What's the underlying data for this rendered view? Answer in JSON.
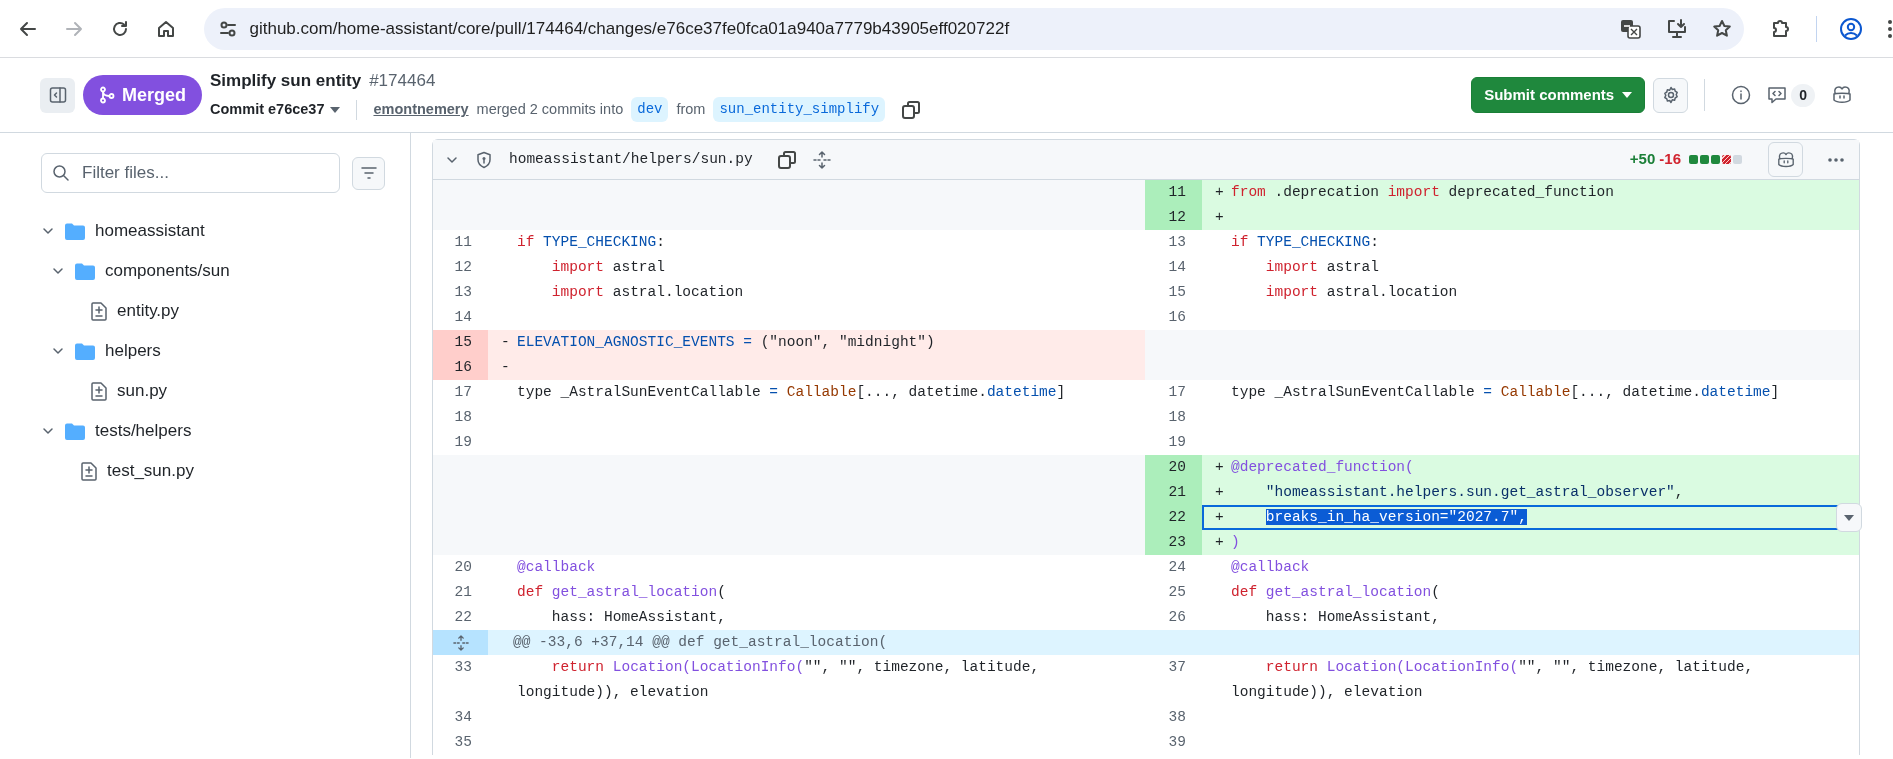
{
  "browser": {
    "url": "github.com/home-assistant/core/pull/174464/changes/e76ce37fe0fca01a940a7779b43905eff020722f",
    "forward_disabled": true
  },
  "header": {
    "status": "Merged",
    "title": "Simplify sun entity",
    "number": "#174464",
    "commit": "Commit e76ce37",
    "author": "emontnemery",
    "merge_text": "merged 2 commits into",
    "base": "dev",
    "from_text": "from",
    "head": "sun_entity_simplify",
    "submit": "Submit comments",
    "comment_count": "0"
  },
  "sidebar": {
    "filter": {
      "placeholder": "Filter files..."
    },
    "tree": [
      {
        "kind": "folder",
        "label": "homeassistant",
        "expanded": true,
        "children": [
          {
            "kind": "folder",
            "label": "components/sun",
            "expanded": true,
            "children": [
              {
                "kind": "file",
                "label": "entity.py"
              }
            ]
          },
          {
            "kind": "folder",
            "label": "helpers",
            "expanded": true,
            "children": [
              {
                "kind": "file",
                "label": "sun.py"
              }
            ]
          }
        ]
      },
      {
        "kind": "folder",
        "label": "tests/helpers",
        "expanded": true,
        "children": [
          {
            "kind": "file",
            "label": "test_sun.py"
          }
        ]
      }
    ]
  },
  "file": {
    "path": "homeassistant/helpers/sun.py",
    "expanded": true,
    "additions": "+50",
    "deletions": "-16",
    "diffstat": [
      {
        "kind": "added"
      },
      {
        "kind": "added"
      },
      {
        "kind": "added"
      },
      {
        "kind": "deleted"
      },
      {
        "kind": "neutral"
      }
    ],
    "rows": [
      {
        "kind": "pair",
        "left": {
          "kind": "empty"
        },
        "right": {
          "kind": "added",
          "num": "11",
          "sign": "+",
          "selected": false,
          "tokens": [
            {
              "kind": "kw",
              "text": "from"
            },
            {
              "kind": "plain",
              "text": " .deprecation "
            },
            {
              "kind": "kw",
              "text": "import"
            },
            {
              "kind": "plain",
              "text": " deprecated_function"
            }
          ]
        }
      },
      {
        "kind": "pair",
        "left": {
          "kind": "empty"
        },
        "right": {
          "kind": "added",
          "num": "12",
          "sign": "+",
          "selected": false
        }
      },
      {
        "kind": "pair",
        "left": {
          "kind": "context",
          "num": "11",
          "selected": false,
          "tokens": [
            {
              "kind": "kw",
              "text": "if "
            },
            {
              "kind": "const",
              "text": "TYPE_CHECKING"
            },
            {
              "kind": "plain",
              "text": ":"
            }
          ]
        },
        "right": {
          "kind": "context",
          "num": "13",
          "selected": false,
          "tokens": [
            {
              "kind": "kw",
              "text": "if "
            },
            {
              "kind": "const",
              "text": "TYPE_CHECKING"
            },
            {
              "kind": "plain",
              "text": ":"
            }
          ]
        }
      },
      {
        "kind": "pair",
        "left": {
          "kind": "context",
          "num": "12",
          "selected": false,
          "tokens": [
            {
              "kind": "kw",
              "text": "    import"
            },
            {
              "kind": "plain",
              "text": " astral"
            }
          ]
        },
        "right": {
          "kind": "context",
          "num": "14",
          "selected": false,
          "tokens": [
            {
              "kind": "kw",
              "text": "    import"
            },
            {
              "kind": "plain",
              "text": " astral"
            }
          ]
        }
      },
      {
        "kind": "pair",
        "left": {
          "kind": "context",
          "num": "13",
          "selected": false,
          "tokens": [
            {
              "kind": "kw",
              "text": "    import"
            },
            {
              "kind": "plain",
              "text": " astral.location"
            }
          ]
        },
        "right": {
          "kind": "context",
          "num": "15",
          "selected": false,
          "tokens": [
            {
              "kind": "kw",
              "text": "    import"
            },
            {
              "kind": "plain",
              "text": " astral.location"
            }
          ]
        }
      },
      {
        "kind": "pair",
        "left": {
          "kind": "context",
          "num": "14",
          "selected": false
        },
        "right": {
          "kind": "context",
          "num": "16",
          "selected": false
        }
      },
      {
        "kind": "pair",
        "left": {
          "kind": "deleted",
          "num": "15",
          "sign": "-",
          "selected": false,
          "tokens": [
            {
              "kind": "const",
              "text": "ELEVATION_AGNOSTIC_EVENTS"
            },
            {
              "kind": "const",
              "text": " ="
            },
            {
              "kind": "plain",
              "text": " (\"noon\", \"midnight\")"
            }
          ]
        },
        "right": {
          "kind": "empty"
        }
      },
      {
        "kind": "pair",
        "left": {
          "kind": "deleted",
          "num": "16",
          "sign": "-",
          "selected": false
        },
        "right": {
          "kind": "empty"
        }
      },
      {
        "kind": "pair",
        "left": {
          "kind": "context",
          "num": "17",
          "selected": false,
          "tokens": [
            {
              "kind": "plain",
              "text": "type _AstralSunEventCallable "
            },
            {
              "kind": "const",
              "text": "="
            },
            {
              "kind": "cls",
              "text": " Callable"
            },
            {
              "kind": "plain",
              "text": "[..., datetime."
            },
            {
              "kind": "const",
              "text": "datetime"
            },
            {
              "kind": "plain",
              "text": "]"
            }
          ]
        },
        "right": {
          "kind": "context",
          "num": "17",
          "selected": false,
          "tokens": [
            {
              "kind": "plain",
              "text": "type _AstralSunEventCallable "
            },
            {
              "kind": "const",
              "text": "="
            },
            {
              "kind": "cls",
              "text": " Callable"
            },
            {
              "kind": "plain",
              "text": "[..., datetime."
            },
            {
              "kind": "const",
              "text": "datetime"
            },
            {
              "kind": "plain",
              "text": "]"
            }
          ]
        }
      },
      {
        "kind": "pair",
        "left": {
          "kind": "context",
          "num": "18",
          "selected": false
        },
        "right": {
          "kind": "context",
          "num": "18",
          "selected": false
        }
      },
      {
        "kind": "pair",
        "left": {
          "kind": "context",
          "num": "19",
          "selected": false
        },
        "right": {
          "kind": "context",
          "num": "19",
          "selected": false
        }
      },
      {
        "kind": "pair",
        "left": {
          "kind": "empty"
        },
        "right": {
          "kind": "added",
          "num": "20",
          "sign": "+",
          "selected": false,
          "tokens": [
            {
              "kind": "func",
              "text": "@deprecated_function("
            }
          ]
        }
      },
      {
        "kind": "pair",
        "left": {
          "kind": "empty"
        },
        "right": {
          "kind": "added",
          "num": "21",
          "sign": "+",
          "selected": false,
          "tokens": [
            {
              "kind": "str",
              "text": "    \"homeassistant.helpers.sun.get_astral_observer\""
            },
            {
              "kind": "plain",
              "text": ","
            }
          ]
        }
      },
      {
        "kind": "pair",
        "left": {
          "kind": "empty"
        },
        "right": {
          "kind": "added",
          "num": "22",
          "sign": "+",
          "selected": true,
          "tokens": [
            {
              "kind": "plain",
              "text": "    breaks_in_ha_version="
            },
            {
              "kind": "str",
              "text": "\"2027.7\""
            },
            {
              "kind": "plain",
              "text": ","
            }
          ]
        }
      },
      {
        "kind": "pair",
        "left": {
          "kind": "empty"
        },
        "right": {
          "kind": "added",
          "num": "23",
          "sign": "+",
          "selected": false,
          "tokens": [
            {
              "kind": "func",
              "text": ")"
            }
          ]
        }
      },
      {
        "kind": "pair",
        "left": {
          "kind": "context",
          "num": "20",
          "selected": false,
          "tokens": [
            {
              "kind": "func",
              "text": "@callback"
            }
          ]
        },
        "right": {
          "kind": "context",
          "num": "24",
          "selected": false,
          "tokens": [
            {
              "kind": "func",
              "text": "@callback"
            }
          ]
        }
      },
      {
        "kind": "pair",
        "left": {
          "kind": "context",
          "num": "21",
          "selected": false,
          "tokens": [
            {
              "kind": "kw",
              "text": "def "
            },
            {
              "kind": "func",
              "text": "get_astral_location"
            },
            {
              "kind": "plain",
              "text": "("
            }
          ]
        },
        "right": {
          "kind": "context",
          "num": "25",
          "selected": false,
          "tokens": [
            {
              "kind": "kw",
              "text": "def "
            },
            {
              "kind": "func",
              "text": "get_astral_location"
            },
            {
              "kind": "plain",
              "text": "("
            }
          ]
        }
      },
      {
        "kind": "pair",
        "left": {
          "kind": "context",
          "num": "22",
          "selected": false,
          "tokens": [
            {
              "kind": "plain",
              "text": "    hass: HomeAssistant,"
            }
          ]
        },
        "right": {
          "kind": "context",
          "num": "26",
          "selected": false,
          "tokens": [
            {
              "kind": "plain",
              "text": "    hass: HomeAssistant,"
            }
          ]
        }
      },
      {
        "kind": "hunk",
        "text": "@@ -33,6 +37,14 @@ def get_astral_location("
      },
      {
        "kind": "pair",
        "left": {
          "kind": "context",
          "num": "33",
          "selected": false,
          "tokens": [
            {
              "kind": "kw",
              "text": "    return"
            },
            {
              "kind": "func",
              "text": " Location(LocationInfo("
            },
            {
              "kind": "plain",
              "text": "\"\", \"\", timezone, latitude, longitude)), elevation"
            }
          ]
        },
        "right": {
          "kind": "context",
          "num": "37",
          "selected": false,
          "tokens": [
            {
              "kind": "kw",
              "text": "    return"
            },
            {
              "kind": "func",
              "text": " Location(LocationInfo("
            },
            {
              "kind": "plain",
              "text": "\"\", \"\", timezone, latitude, longitude)), elevation"
            }
          ]
        }
      },
      {
        "kind": "pair",
        "left": {
          "kind": "context",
          "num": "34",
          "selected": false
        },
        "right": {
          "kind": "context",
          "num": "38",
          "selected": false
        }
      },
      {
        "kind": "pair",
        "left": {
          "kind": "context",
          "num": "35",
          "selected": false
        },
        "right": {
          "kind": "context",
          "num": "39",
          "selected": false
        }
      }
    ]
  }
}
